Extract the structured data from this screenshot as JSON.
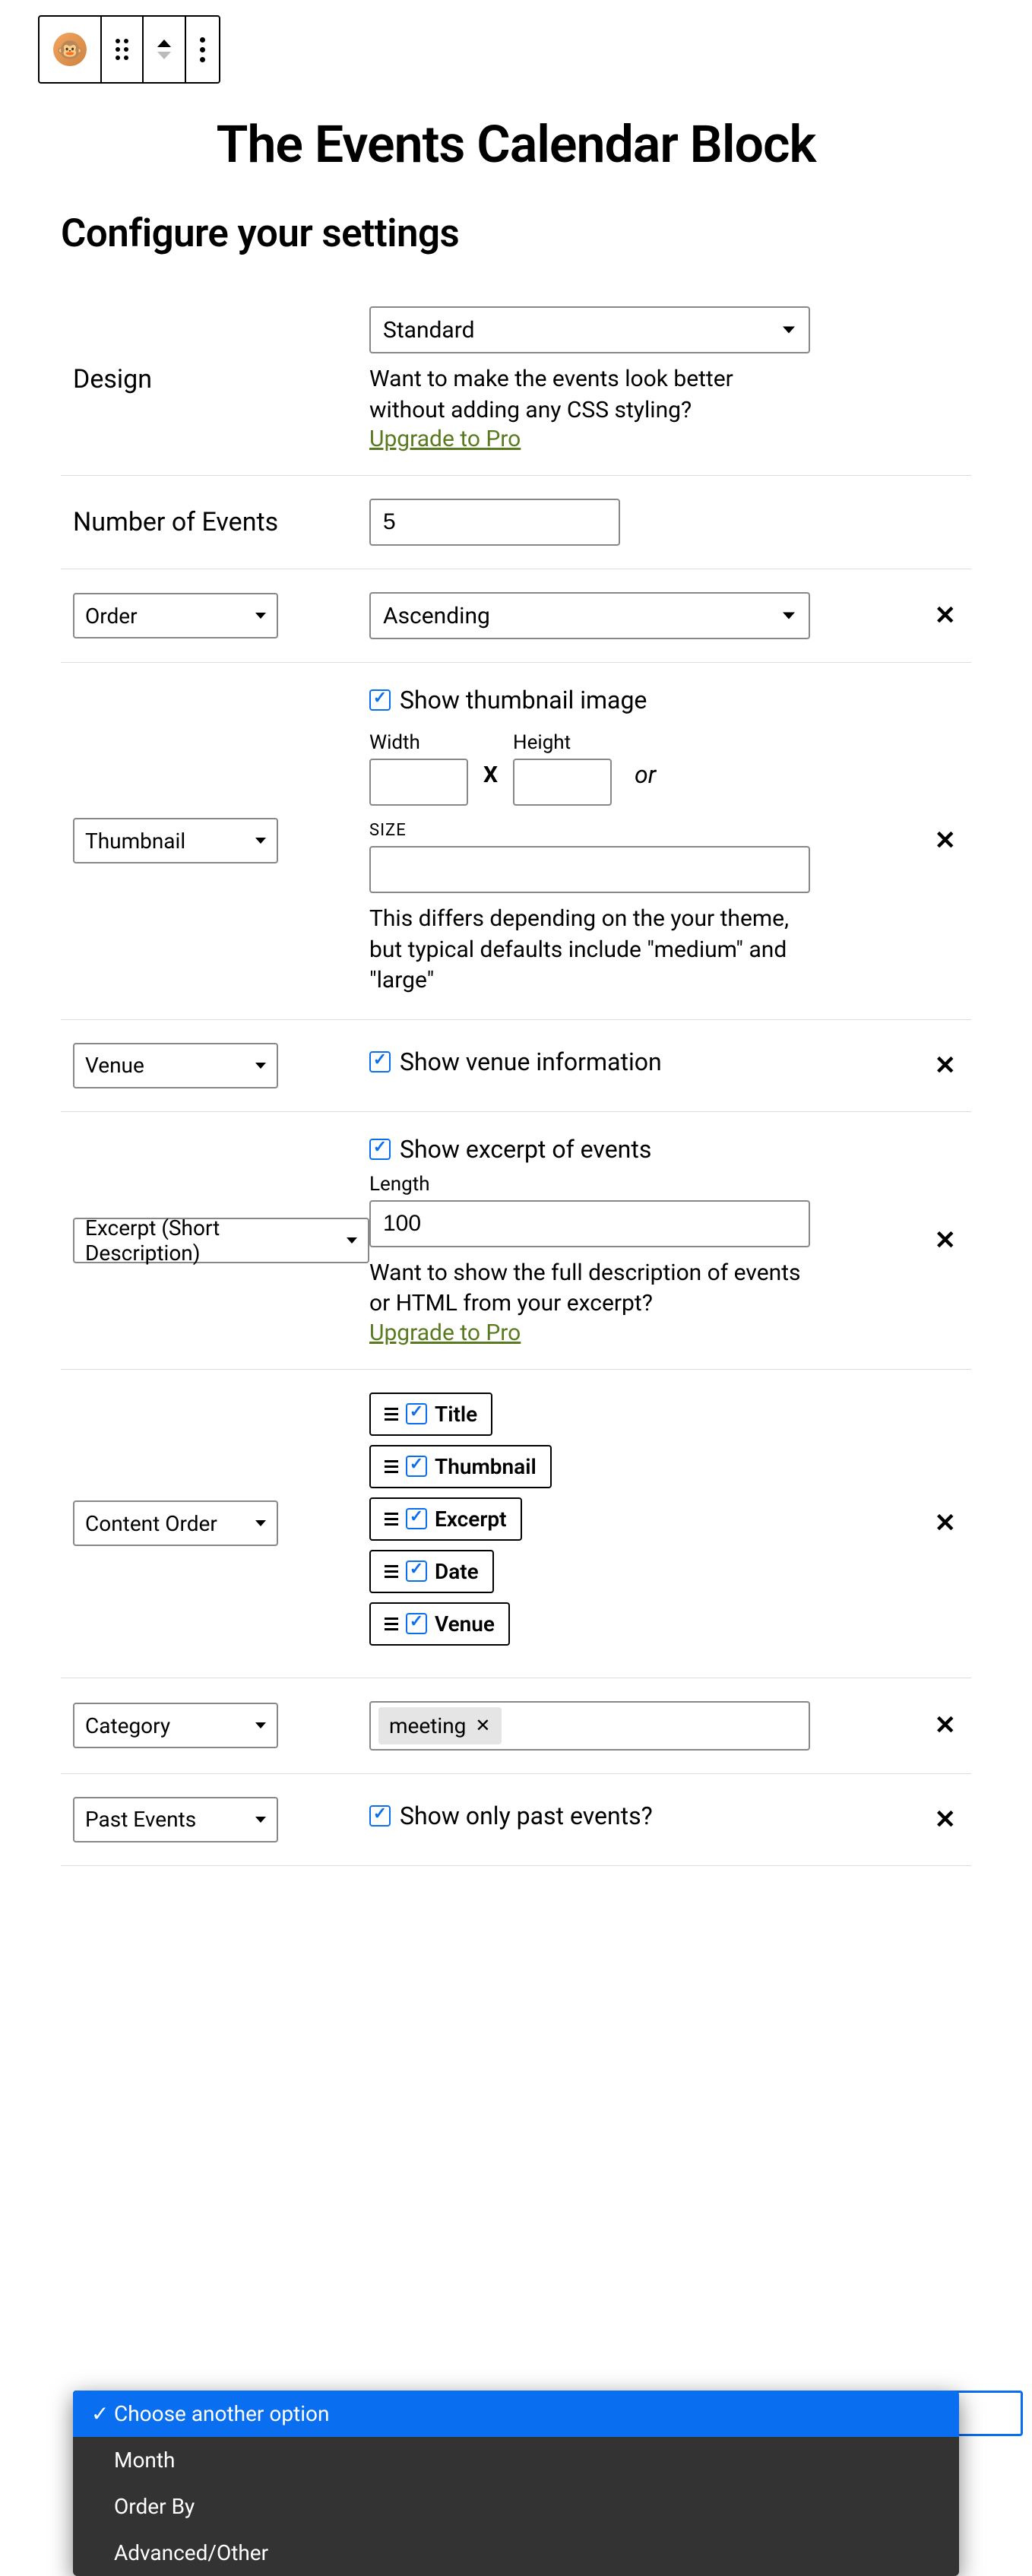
{
  "title": "The Events Calendar Block",
  "subtitle": "Configure your settings",
  "design": {
    "label": "Design",
    "value": "Standard",
    "helper": "Want to make the events look better without adding any CSS styling?",
    "upgrade": "Upgrade to Pro"
  },
  "numEvents": {
    "label": "Number of Events",
    "value": "5"
  },
  "order": {
    "label": "Order",
    "value": "Ascending"
  },
  "thumbnail": {
    "label": "Thumbnail",
    "cbLabel": "Show thumbnail image",
    "widthLabel": "Width",
    "heightLabel": "Height",
    "widthValue": "",
    "heightValue": "",
    "orText": "or",
    "sizeLabel": "SIZE",
    "sizeValue": "",
    "helper": "This differs depending on the your theme, but typical defaults include \"medium\" and \"large\""
  },
  "venue": {
    "label": "Venue",
    "cbLabel": "Show venue information"
  },
  "excerpt": {
    "label": "Excerpt (Short Description)",
    "cbLabel": "Show excerpt of events",
    "lengthLabel": "Length",
    "lengthValue": "100",
    "helper": "Want to show the full description of events or HTML from your excerpt?",
    "upgrade": "Upgrade to Pro"
  },
  "contentOrder": {
    "label": "Content Order",
    "items": [
      "Title",
      "Thumbnail",
      "Excerpt",
      "Date",
      "Venue"
    ]
  },
  "category": {
    "label": "Category",
    "tag": "meeting"
  },
  "pastEvents": {
    "label": "Past Events",
    "cbLabel": "Show only past events?"
  },
  "dropdown": {
    "selected": "Choose another option",
    "items": [
      "Month",
      "Order By",
      "Advanced/Other"
    ]
  }
}
